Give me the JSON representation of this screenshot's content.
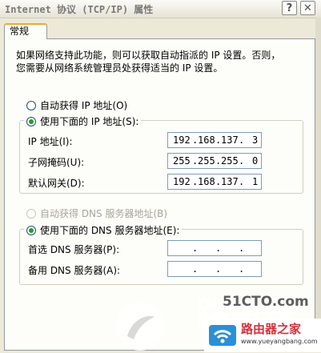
{
  "window": {
    "title": "Internet 协议 (TCP/IP) 属性",
    "help_glyph": "?",
    "close_glyph": "✕"
  },
  "tabs": [
    {
      "label": "常规",
      "selected": true
    }
  ],
  "description": [
    "如果网络支持此功能，则可以获取自动指派的 IP 设置。否则，",
    "您需要从网络系统管理员处获得适当的 IP 设置。"
  ],
  "ip": {
    "auto_label": "自动获得 IP 地址(O)",
    "manual_label": "使用下面的 IP 地址(S):",
    "mode": "manual",
    "fields": [
      {
        "label": "IP 地址(I):",
        "octets": [
          "192",
          "168",
          "137",
          "3"
        ]
      },
      {
        "label": "子网掩码(U):",
        "octets": [
          "255",
          "255",
          "255",
          "0"
        ]
      },
      {
        "label": "默认网关(D):",
        "octets": [
          "192",
          "168",
          "137",
          "1"
        ]
      }
    ]
  },
  "dns": {
    "auto_label": "自动获得 DNS 服务器地址(B)",
    "manual_label": "使用下面的 DNS 服务器地址(E):",
    "mode": "manual",
    "fields": [
      {
        "label": "首选 DNS 服务器(P):",
        "octets": [
          "",
          "",
          "",
          ""
        ]
      },
      {
        "label": "备用 DNS 服务器(A):",
        "octets": [
          "",
          "",
          "",
          ""
        ]
      }
    ]
  },
  "watermark": {
    "site_text": "51CTO.com",
    "brand_name": "路由器之家",
    "brand_url": "www.yueyangbang.com"
  },
  "colors": {
    "dialog_bg": "#ece9d8",
    "panel_bg": "#fdfdf9",
    "tab_accent": "#f3a43b",
    "radio_check": "#21a121",
    "field_border": "#7f9db9",
    "brand_red": "#d6303a"
  }
}
